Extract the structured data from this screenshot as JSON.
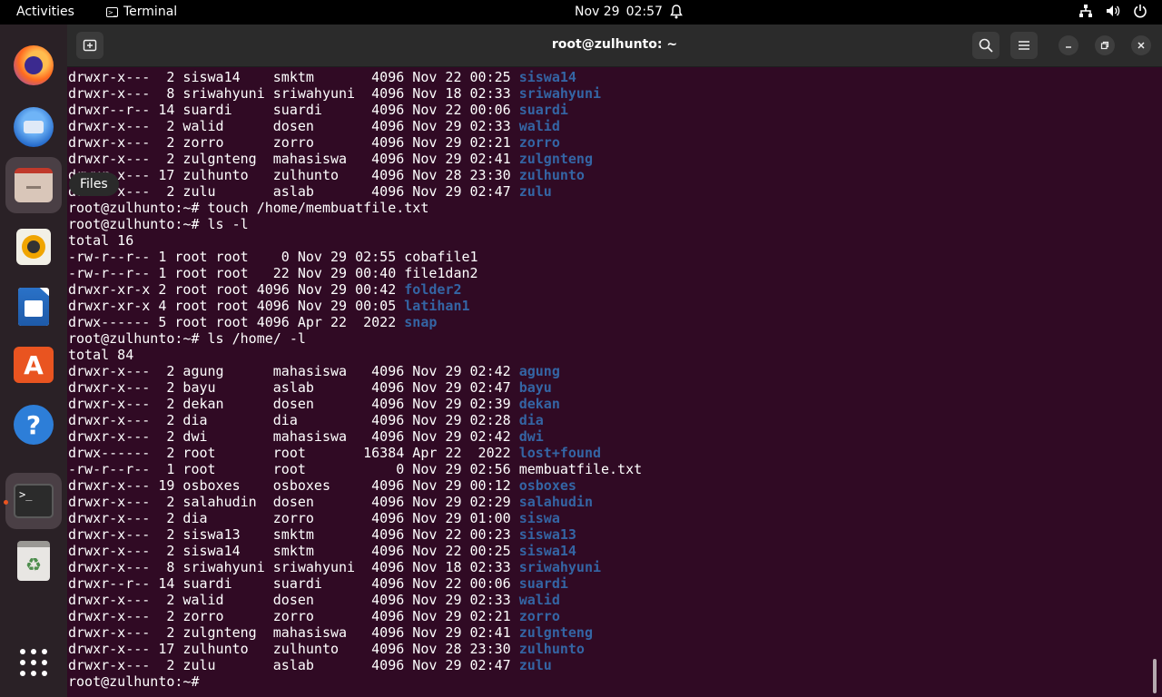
{
  "topbar": {
    "activities": "Activities",
    "app_name": "Terminal",
    "date": "Nov 29",
    "time": "02:57"
  },
  "dock": {
    "tooltip": "Files"
  },
  "window": {
    "title": "root@zulhunto: ~"
  },
  "colors": {
    "dir": "#3465a4",
    "bg": "#300a24"
  },
  "terminal": {
    "lines": [
      {
        "p": "drwxr-x---  2 siswa14    smktm       4096 Nov 22 00:25 ",
        "d": "siswa14"
      },
      {
        "p": "drwxr-x---  8 sriwahyuni sriwahyuni  4096 Nov 18 02:33 ",
        "d": "sriwahyuni"
      },
      {
        "p": "drwxr--r-- 14 suardi     suardi      4096 Nov 22 00:06 ",
        "d": "suardi"
      },
      {
        "p": "drwxr-x---  2 walid      dosen       4096 Nov 29 02:33 ",
        "d": "walid"
      },
      {
        "p": "drwxr-x---  2 zorro      zorro       4096 Nov 29 02:21 ",
        "d": "zorro"
      },
      {
        "p": "drwxr-x---  2 zulgnteng  mahasiswa   4096 Nov 29 02:41 ",
        "d": "zulgnteng"
      },
      {
        "p": "drwxr-x--- 17 zulhunto   zulhunto    4096 Nov 28 23:30 ",
        "d": "zulhunto"
      },
      {
        "p": "drwxr-x---  2 zulu       aslab       4096 Nov 29 02:47 ",
        "d": "zulu"
      },
      {
        "p": "root@zulhunto:~# touch /home/membuatfile.txt"
      },
      {
        "p": "root@zulhunto:~# ls -l"
      },
      {
        "p": "total 16"
      },
      {
        "p": "-rw-r--r-- 1 root root    0 Nov 29 02:55 cobafile1"
      },
      {
        "p": "-rw-r--r-- 1 root root   22 Nov 29 00:40 file1dan2"
      },
      {
        "p": "drwxr-xr-x 2 root root 4096 Nov 29 00:42 ",
        "d": "folder2"
      },
      {
        "p": "drwxr-xr-x 4 root root 4096 Nov 29 00:05 ",
        "d": "latihan1"
      },
      {
        "p": "drwx------ 5 root root 4096 Apr 22  2022 ",
        "d": "snap"
      },
      {
        "p": "root@zulhunto:~# ls /home/ -l"
      },
      {
        "p": "total 84"
      },
      {
        "p": "drwxr-x---  2 agung      mahasiswa   4096 Nov 29 02:42 ",
        "d": "agung"
      },
      {
        "p": "drwxr-x---  2 bayu       aslab       4096 Nov 29 02:47 ",
        "d": "bayu"
      },
      {
        "p": "drwxr-x---  2 dekan      dosen       4096 Nov 29 02:39 ",
        "d": "dekan"
      },
      {
        "p": "drwxr-x---  2 dia        dia         4096 Nov 29 02:28 ",
        "d": "dia"
      },
      {
        "p": "drwxr-x---  2 dwi        mahasiswa   4096 Nov 29 02:42 ",
        "d": "dwi"
      },
      {
        "p": "drwx------  2 root       root       16384 Apr 22  2022 ",
        "d": "lost+found"
      },
      {
        "p": "-rw-r--r--  1 root       root           0 Nov 29 02:56 membuatfile.txt"
      },
      {
        "p": "drwxr-x--- 19 osboxes    osboxes     4096 Nov 29 00:12 ",
        "d": "osboxes"
      },
      {
        "p": "drwxr-x---  2 salahudin  dosen       4096 Nov 29 02:29 ",
        "d": "salahudin"
      },
      {
        "p": "drwxr-x---  2 dia        zorro       4096 Nov 29 01:00 ",
        "d": "siswa"
      },
      {
        "p": "drwxr-x---  2 siswa13    smktm       4096 Nov 22 00:23 ",
        "d": "siswa13"
      },
      {
        "p": "drwxr-x---  2 siswa14    smktm       4096 Nov 22 00:25 ",
        "d": "siswa14"
      },
      {
        "p": "drwxr-x---  8 sriwahyuni sriwahyuni  4096 Nov 18 02:33 ",
        "d": "sriwahyuni"
      },
      {
        "p": "drwxr--r-- 14 suardi     suardi      4096 Nov 22 00:06 ",
        "d": "suardi"
      },
      {
        "p": "drwxr-x---  2 walid      dosen       4096 Nov 29 02:33 ",
        "d": "walid"
      },
      {
        "p": "drwxr-x---  2 zorro      zorro       4096 Nov 29 02:21 ",
        "d": "zorro"
      },
      {
        "p": "drwxr-x---  2 zulgnteng  mahasiswa   4096 Nov 29 02:41 ",
        "d": "zulgnteng"
      },
      {
        "p": "drwxr-x--- 17 zulhunto   zulhunto    4096 Nov 28 23:30 ",
        "d": "zulhunto"
      },
      {
        "p": "drwxr-x---  2 zulu       aslab       4096 Nov 29 02:47 ",
        "d": "zulu"
      },
      {
        "p": "root@zulhunto:~# "
      }
    ]
  }
}
